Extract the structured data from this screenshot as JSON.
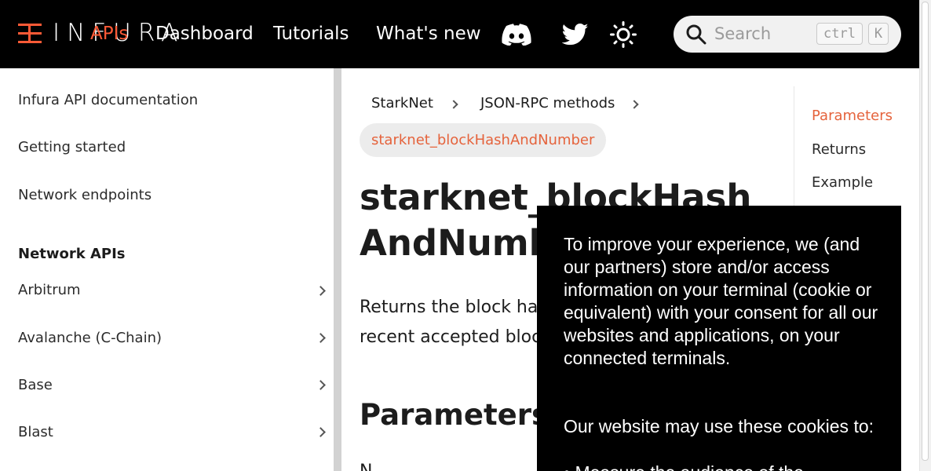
{
  "navbar": {
    "logo_text": "INFURA",
    "links": [
      "APIs",
      "Dashboard",
      "Tutorials",
      "What's new"
    ],
    "icons": [
      "discord-icon",
      "twitter-icon",
      "theme-toggle-icon"
    ],
    "search": {
      "placeholder": "Search",
      "kbd": [
        "ctrl",
        "K"
      ]
    },
    "accent_color": "#ff5a36"
  },
  "sidebar": {
    "top_links": [
      "Infura API documentation",
      "Getting started",
      "Network endpoints"
    ],
    "section_title": "Network APIs",
    "items": [
      "Arbitrum",
      "Avalanche (C-Chain)",
      "Base",
      "Blast"
    ]
  },
  "breadcrumb": {
    "items": [
      "StarkNet",
      "JSON-RPC methods"
    ],
    "current": "starknet_blockHashAndNumber"
  },
  "main": {
    "title": "starknet_blockHashAndNumber",
    "lead_line1": "Returns the block has",
    "lead_line2": "recent accepted block",
    "section_heading": "Parameters",
    "section_fragment": "N"
  },
  "toc": {
    "items": [
      "Parameters",
      "Returns",
      "Example"
    ],
    "active": "Parameters"
  },
  "cookie_banner": {
    "paragraph1": "To improve your experience, we (and our partners) store and/or access information on your terminal (cookie or equivalent) with your consent for all our websites and applications, on your connected terminals.",
    "paragraph2": "Our website may use these cookies to:",
    "bullet1": "•   Measure the audience of the"
  }
}
